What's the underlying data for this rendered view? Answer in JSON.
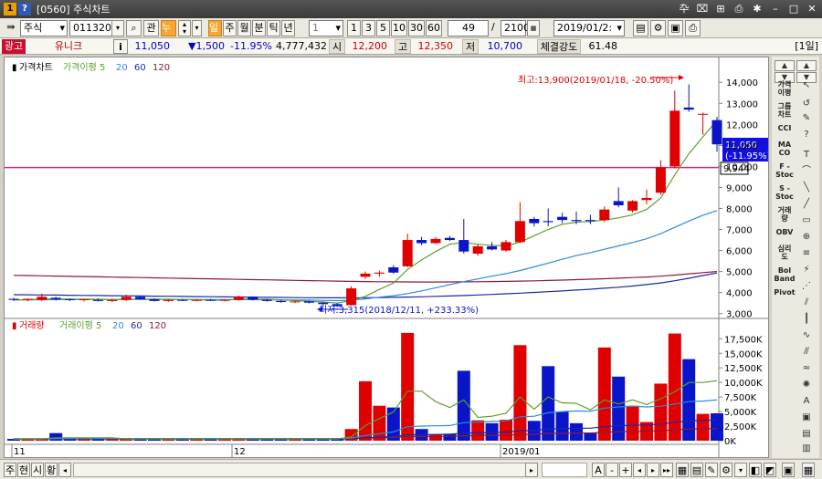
{
  "window": {
    "id": "[0560]",
    "title": "주식차트"
  },
  "toolbar": {
    "market": "주식",
    "code": "011320",
    "btn_kwan": "관",
    "btn_nu": "누",
    "periods": [
      "일",
      "주",
      "월",
      "분",
      "틱",
      "년"
    ],
    "interval_value": "1",
    "counts": [
      "1",
      "3",
      "5",
      "10",
      "30",
      "60"
    ],
    "display_count": "49",
    "total_count": "2100",
    "date": "2019/01/2:"
  },
  "info": {
    "tag": "광고",
    "name": "유니크",
    "info_btn": "i",
    "price": "11,050",
    "change": "▼1,500",
    "change_pct": "-11.95%",
    "volume": "4,777,432",
    "open_label": "시",
    "open": "12,200",
    "high_label": "고",
    "high": "12,350",
    "low_label": "저",
    "low": "10,700",
    "strength_label": "체결강도",
    "strength": "61.48",
    "period_badge": "[1일]"
  },
  "colors": {
    "up": "#e00000",
    "down": "#0a14c8",
    "ma5": "#5aa02c",
    "ma20": "#2f8ad8",
    "ma60": "#1a2aa0",
    "ma120": "#8b1a3a",
    "hline": "#e0207a"
  },
  "chart_data": [
    {
      "type": "candlestick",
      "legend": [
        "가격차트",
        "가격이평 5",
        "20",
        "60",
        "120"
      ],
      "yticks": [
        "14,000",
        "13,000",
        "12,000",
        "11,000",
        "10,000",
        "9,000",
        "8,000",
        "7,000",
        "6,000",
        "5,000",
        "4,000",
        "3,000"
      ],
      "ylim": [
        2900,
        14400
      ],
      "annotation_high": "최고:13,900(2019/01/18, -20.50%)",
      "annotation_low": "최저:3,315(2018/12/11, +233.33%)",
      "current_price_label": "11,050",
      "current_change_label": "(-11.95%)",
      "hline_label": "9,944",
      "hline_value": 9944,
      "candles": [
        {
          "o": 3700,
          "h": 3750,
          "l": 3600,
          "c": 3650
        },
        {
          "o": 3650,
          "h": 3720,
          "l": 3580,
          "c": 3700
        },
        {
          "o": 3650,
          "h": 3950,
          "l": 3600,
          "c": 3800
        },
        {
          "o": 3750,
          "h": 3800,
          "l": 3620,
          "c": 3680
        },
        {
          "o": 3680,
          "h": 3720,
          "l": 3600,
          "c": 3650
        },
        {
          "o": 3640,
          "h": 3700,
          "l": 3580,
          "c": 3680
        },
        {
          "o": 3650,
          "h": 3720,
          "l": 3580,
          "c": 3600
        },
        {
          "o": 3600,
          "h": 3700,
          "l": 3550,
          "c": 3650
        },
        {
          "o": 3650,
          "h": 3900,
          "l": 3600,
          "c": 3800
        },
        {
          "o": 3800,
          "h": 3820,
          "l": 3650,
          "c": 3680
        },
        {
          "o": 3680,
          "h": 3720,
          "l": 3580,
          "c": 3600
        },
        {
          "o": 3600,
          "h": 3680,
          "l": 3560,
          "c": 3650
        },
        {
          "o": 3650,
          "h": 3700,
          "l": 3600,
          "c": 3620
        },
        {
          "o": 3620,
          "h": 3680,
          "l": 3580,
          "c": 3650
        },
        {
          "o": 3650,
          "h": 3700,
          "l": 3600,
          "c": 3620
        },
        {
          "o": 3620,
          "h": 3680,
          "l": 3580,
          "c": 3650
        },
        {
          "o": 3650,
          "h": 3850,
          "l": 3620,
          "c": 3800
        },
        {
          "o": 3800,
          "h": 3820,
          "l": 3620,
          "c": 3660
        },
        {
          "o": 3660,
          "h": 3700,
          "l": 3560,
          "c": 3600
        },
        {
          "o": 3600,
          "h": 3650,
          "l": 3520,
          "c": 3550
        },
        {
          "o": 3550,
          "h": 3620,
          "l": 3500,
          "c": 3580
        },
        {
          "o": 3580,
          "h": 3600,
          "l": 3480,
          "c": 3520
        },
        {
          "o": 3520,
          "h": 3560,
          "l": 3400,
          "c": 3450
        },
        {
          "o": 3450,
          "h": 3500,
          "l": 3315,
          "c": 3350
        },
        {
          "o": 3400,
          "h": 4300,
          "l": 3380,
          "c": 4200
        },
        {
          "o": 4750,
          "h": 5000,
          "l": 4650,
          "c": 4900
        },
        {
          "o": 4900,
          "h": 5050,
          "l": 4750,
          "c": 4950
        },
        {
          "o": 5200,
          "h": 5300,
          "l": 4900,
          "c": 4950
        },
        {
          "o": 5250,
          "h": 6800,
          "l": 5200,
          "c": 6500
        },
        {
          "o": 6500,
          "h": 6650,
          "l": 6250,
          "c": 6350
        },
        {
          "o": 6350,
          "h": 6650,
          "l": 6300,
          "c": 6550
        },
        {
          "o": 6600,
          "h": 6700,
          "l": 6450,
          "c": 6500
        },
        {
          "o": 6500,
          "h": 7500,
          "l": 5850,
          "c": 5950
        },
        {
          "o": 5850,
          "h": 6300,
          "l": 5750,
          "c": 6200
        },
        {
          "o": 6200,
          "h": 6400,
          "l": 6000,
          "c": 6050
        },
        {
          "o": 6000,
          "h": 6500,
          "l": 5950,
          "c": 6400
        },
        {
          "o": 6400,
          "h": 8300,
          "l": 6350,
          "c": 7400
        },
        {
          "o": 7500,
          "h": 7600,
          "l": 7150,
          "c": 7300
        },
        {
          "o": 7400,
          "h": 8000,
          "l": 7150,
          "c": 7350
        },
        {
          "o": 7600,
          "h": 7800,
          "l": 7300,
          "c": 7450
        },
        {
          "o": 7450,
          "h": 7850,
          "l": 7250,
          "c": 7400
        },
        {
          "o": 7450,
          "h": 7700,
          "l": 7250,
          "c": 7400
        },
        {
          "o": 7450,
          "h": 8100,
          "l": 7350,
          "c": 7950
        },
        {
          "o": 8350,
          "h": 9000,
          "l": 8050,
          "c": 8150
        },
        {
          "o": 7900,
          "h": 8400,
          "l": 7800,
          "c": 8350
        },
        {
          "o": 8400,
          "h": 8900,
          "l": 8200,
          "c": 8500
        },
        {
          "o": 8750,
          "h": 10300,
          "l": 8650,
          "c": 9950
        },
        {
          "o": 10000,
          "h": 13600,
          "l": 9900,
          "c": 12650
        },
        {
          "o": 12800,
          "h": 13900,
          "l": 12600,
          "c": 12700
        },
        {
          "o": 12500,
          "h": 12550,
          "l": 11500,
          "c": 12500
        },
        {
          "o": 12200,
          "h": 12350,
          "l": 10700,
          "c": 11050
        }
      ],
      "ma5": [
        3650,
        3660,
        3690,
        3700,
        3690,
        3690,
        3680,
        3660,
        3680,
        3690,
        3690,
        3680,
        3670,
        3660,
        3640,
        3640,
        3680,
        3690,
        3680,
        3650,
        3620,
        3580,
        3550,
        3500,
        3620,
        3820,
        4150,
        4450,
        5100,
        5550,
        5950,
        6300,
        6380,
        6300,
        6250,
        6220,
        6400,
        6700,
        7000,
        7250,
        7350,
        7380,
        7450,
        7550,
        7700,
        7950,
        8500,
        9600,
        10600,
        11400,
        12200
      ],
      "ma20": [
        3650,
        3655,
        3660,
        3665,
        3668,
        3670,
        3670,
        3670,
        3672,
        3675,
        3675,
        3673,
        3670,
        3668,
        3665,
        3663,
        3663,
        3665,
        3660,
        3655,
        3648,
        3640,
        3630,
        3615,
        3640,
        3700,
        3780,
        3850,
        3950,
        4080,
        4230,
        4380,
        4520,
        4650,
        4780,
        4900,
        5050,
        5220,
        5400,
        5580,
        5760,
        5900,
        6060,
        6220,
        6380,
        6560,
        6800,
        7100,
        7400,
        7680,
        7900
      ],
      "ma60": [
        3900,
        3893,
        3886,
        3879,
        3872,
        3865,
        3858,
        3851,
        3844,
        3837,
        3830,
        3823,
        3816,
        3809,
        3802,
        3795,
        3788,
        3781,
        3774,
        3767,
        3760,
        3755,
        3752,
        3752,
        3752,
        3755,
        3762,
        3772,
        3785,
        3800,
        3818,
        3838,
        3860,
        3885,
        3912,
        3942,
        3972,
        4005,
        4040,
        4078,
        4118,
        4160,
        4205,
        4255,
        4310,
        4380,
        4460,
        4560,
        4680,
        4810,
        4930
      ],
      "ma120": [
        4820,
        4808,
        4796,
        4784,
        4772,
        4760,
        4748,
        4736,
        4724,
        4712,
        4700,
        4688,
        4676,
        4664,
        4652,
        4640,
        4628,
        4616,
        4604,
        4592,
        4580,
        4568,
        4556,
        4544,
        4532,
        4522,
        4514,
        4508,
        4504,
        4502,
        4502,
        4504,
        4508,
        4514,
        4522,
        4532,
        4544,
        4558,
        4574,
        4592,
        4612,
        4634,
        4658,
        4684,
        4712,
        4742,
        4780,
        4830,
        4890,
        4950,
        5000
      ]
    },
    {
      "type": "bar",
      "legend": [
        "거래량",
        "거래이평 5",
        "20",
        "60",
        "120"
      ],
      "yticks": [
        "17,500K",
        "15,000K",
        "12,500K",
        "10,000K",
        "7,500K",
        "5,000K",
        "2,500K",
        "0K"
      ],
      "ylim": [
        0,
        18800
      ],
      "x_labels": [
        "11",
        "12",
        "2019/01"
      ],
      "volumes": [
        300,
        300,
        300,
        1300,
        300,
        300,
        300,
        300,
        300,
        300,
        300,
        300,
        300,
        300,
        300,
        300,
        300,
        300,
        300,
        300,
        300,
        300,
        300,
        300,
        2000,
        10200,
        6000,
        5700,
        18500,
        2000,
        1100,
        1200,
        12000,
        3500,
        3000,
        3600,
        16400,
        3400,
        12800,
        5000,
        3000,
        1400,
        16000,
        11000,
        6000,
        3200,
        9800,
        18400,
        14000,
        4600,
        4700
      ],
      "vol_ma5": [
        300,
        300,
        300,
        500,
        500,
        500,
        500,
        500,
        300,
        300,
        300,
        300,
        300,
        300,
        300,
        300,
        300,
        300,
        300,
        300,
        300,
        300,
        300,
        300,
        650,
        2600,
        3800,
        4900,
        8500,
        8500,
        6700,
        5700,
        7000,
        4000,
        4200,
        4700,
        7500,
        5400,
        7500,
        6500,
        6400,
        5300,
        7000,
        6300,
        7000,
        6200,
        7200,
        8400,
        10000,
        10000,
        10300
      ],
      "vol_ma20": [
        320,
        320,
        320,
        360,
        360,
        360,
        360,
        360,
        360,
        360,
        360,
        360,
        360,
        360,
        360,
        360,
        360,
        360,
        360,
        360,
        360,
        360,
        360,
        360,
        450,
        900,
        1200,
        1500,
        2400,
        2500,
        2550,
        2600,
        3100,
        3200,
        3300,
        3400,
        4100,
        4200,
        4800,
        5000,
        5100,
        5050,
        5600,
        5800,
        5900,
        5800,
        5900,
        6300,
        6700,
        6800,
        7000
      ],
      "vol_ma60": [
        300,
        300,
        300,
        310,
        310,
        310,
        310,
        310,
        310,
        310,
        310,
        310,
        310,
        310,
        310,
        310,
        310,
        310,
        310,
        310,
        310,
        310,
        310,
        310,
        340,
        500,
        600,
        700,
        1000,
        1050,
        1070,
        1100,
        1300,
        1350,
        1400,
        1450,
        1700,
        1750,
        2000,
        2080,
        2130,
        2150,
        2400,
        2550,
        2650,
        2700,
        2850,
        3150,
        3400,
        3480,
        3560
      ],
      "vol_ma120": [
        350,
        350,
        350,
        355,
        355,
        355,
        355,
        355,
        355,
        355,
        355,
        355,
        355,
        355,
        355,
        355,
        355,
        355,
        355,
        355,
        355,
        355,
        355,
        355,
        370,
        450,
        500,
        560,
        700,
        720,
        730,
        750,
        850,
        880,
        910,
        940,
        1070,
        1100,
        1230,
        1270,
        1300,
        1310,
        1440,
        1540,
        1600,
        1630,
        1710,
        1870,
        2000,
        2040,
        2080
      ]
    }
  ],
  "bottom": {
    "labels": [
      "주",
      "현",
      "시",
      "황"
    ],
    "zoom_plus": "+",
    "zoom_minus": "-"
  },
  "palette": {
    "items": [
      "가격\n이평",
      "그룹\n차트",
      "CCI",
      "MA\nCO",
      "F -\nStoc",
      "S -\nStoc",
      "거래\n량",
      "OBV",
      "심리\n도",
      "Bol\nBand",
      "Pivot"
    ]
  }
}
